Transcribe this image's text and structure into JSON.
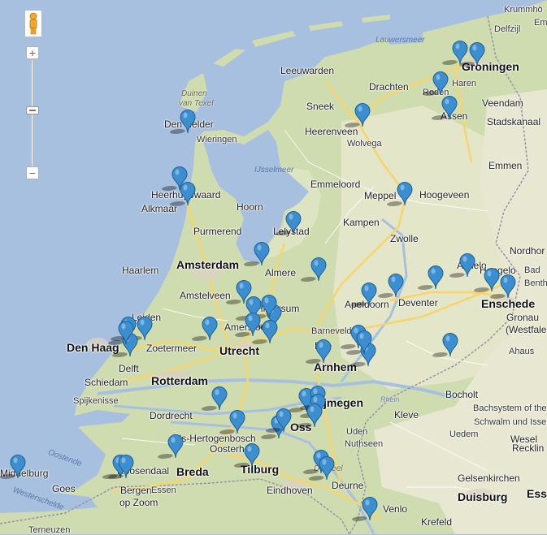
{
  "map": {
    "colors": {
      "water": "#a7c0df",
      "land_green": "#cfdcb0",
      "land_light": "#e6e9cf",
      "road_major": "#f7d56a",
      "road_minor": "#ffffff",
      "border": "#9a8fa6",
      "pin": "#3b8fd0"
    },
    "labels": [
      {
        "text": "Krummhö",
        "type": "small"
      },
      {
        "text": "Delfzijl",
        "type": "small"
      },
      {
        "text": "Em",
        "type": "small"
      },
      {
        "text": "Lauwersmeer",
        "type": "water"
      },
      {
        "text": "Groningen",
        "type": "big"
      },
      {
        "text": "Leeuwarden",
        "type": "normal"
      },
      {
        "text": "Drachten",
        "type": "normal"
      },
      {
        "text": "Haren",
        "type": "small"
      },
      {
        "text": "Roden",
        "type": "small"
      },
      {
        "text": "Duinen",
        "type": "region"
      },
      {
        "text": "van Texel",
        "type": "region"
      },
      {
        "text": "Sneek",
        "type": "normal"
      },
      {
        "text": "Veendam",
        "type": "normal"
      },
      {
        "text": "Assen",
        "type": "normal"
      },
      {
        "text": "Stadskanaal",
        "type": "normal"
      },
      {
        "text": "Den Helder",
        "type": "normal"
      },
      {
        "text": "Heerenveen",
        "type": "normal"
      },
      {
        "text": "Wieringen",
        "type": "small"
      },
      {
        "text": "Wolvega",
        "type": "small"
      },
      {
        "text": "IJsselmeer",
        "type": "water"
      },
      {
        "text": "Emmen",
        "type": "normal"
      },
      {
        "text": "Emmeloord",
        "type": "normal"
      },
      {
        "text": "Heerhugowaard",
        "type": "normal"
      },
      {
        "text": "Hoorn",
        "type": "normal"
      },
      {
        "text": "Meppel",
        "type": "normal"
      },
      {
        "text": "Hoogeveen",
        "type": "normal"
      },
      {
        "text": "Alkmaar",
        "type": "normal"
      },
      {
        "text": "Kampen",
        "type": "normal"
      },
      {
        "text": "Lelystad",
        "type": "normal"
      },
      {
        "text": "Purmerend",
        "type": "normal"
      },
      {
        "text": "Zwolle",
        "type": "normal"
      },
      {
        "text": "Nordhor",
        "type": "normal"
      },
      {
        "text": "Haarlem",
        "type": "normal"
      },
      {
        "text": "Amsterdam",
        "type": "big"
      },
      {
        "text": "Almere",
        "type": "normal"
      },
      {
        "text": "Almelo",
        "type": "normal"
      },
      {
        "text": "Hengelo",
        "type": "normal"
      },
      {
        "text": "Bad",
        "type": "small"
      },
      {
        "text": "Benth",
        "type": "small"
      },
      {
        "text": "Amstelveen",
        "type": "normal"
      },
      {
        "text": "Hilversum",
        "type": "normal"
      },
      {
        "text": "Apeldoorn",
        "type": "normal"
      },
      {
        "text": "Deventer",
        "type": "normal"
      },
      {
        "text": "Enschede",
        "type": "big"
      },
      {
        "text": "Leiden",
        "type": "normal"
      },
      {
        "text": "Amersfoort",
        "type": "normal"
      },
      {
        "text": "Barneveld",
        "type": "small"
      },
      {
        "text": "Gronau",
        "type": "normal"
      },
      {
        "text": "(Westfalen)",
        "type": "normal"
      },
      {
        "text": "Den Haag",
        "type": "big"
      },
      {
        "text": "Zoetermeer",
        "type": "normal"
      },
      {
        "text": "Utrecht",
        "type": "big"
      },
      {
        "text": "Ede",
        "type": "normal"
      },
      {
        "text": "Ahaus",
        "type": "small"
      },
      {
        "text": "Delft",
        "type": "normal"
      },
      {
        "text": "Arnhem",
        "type": "big"
      },
      {
        "text": "Schiedam",
        "type": "normal"
      },
      {
        "text": "Rotterdam",
        "type": "big"
      },
      {
        "text": "Spijkenisse",
        "type": "small"
      },
      {
        "text": "Bocholt",
        "type": "normal"
      },
      {
        "text": "Rhein",
        "type": "river"
      },
      {
        "text": "Nijmegen",
        "type": "big"
      },
      {
        "text": "Bachsystem of the",
        "type": "small"
      },
      {
        "text": "Dordrecht",
        "type": "normal"
      },
      {
        "text": "Kleve",
        "type": "normal"
      },
      {
        "text": "Schwalm und Issel",
        "type": "small"
      },
      {
        "text": "Oss",
        "type": "big"
      },
      {
        "text": "Uedem",
        "type": "small"
      },
      {
        "text": "Wesel",
        "type": "normal"
      },
      {
        "text": "Uden",
        "type": "small"
      },
      {
        "text": "'s-Hertogenbosch",
        "type": "normal"
      },
      {
        "text": "Nuthseen",
        "type": "small"
      },
      {
        "text": "Oosterhout",
        "type": "normal"
      },
      {
        "text": "Recklin",
        "type": "normal"
      },
      {
        "text": "Oostende",
        "type": "water"
      },
      {
        "text": "Roosendaal",
        "type": "normal"
      },
      {
        "text": "Breda",
        "type": "big"
      },
      {
        "text": "Tilburg",
        "type": "big"
      },
      {
        "text": "De Peel",
        "type": "region"
      },
      {
        "text": "Middelburg",
        "type": "normal"
      },
      {
        "text": "Goes",
        "type": "normal"
      },
      {
        "text": "Bergen",
        "type": "normal"
      },
      {
        "text": "op Zoom",
        "type": "normal"
      },
      {
        "text": "Essen",
        "type": "small"
      },
      {
        "text": "Eindhoven",
        "type": "normal"
      },
      {
        "text": "Deurne",
        "type": "normal"
      },
      {
        "text": "Gelsenkirchen",
        "type": "normal"
      },
      {
        "text": "Ess",
        "type": "big"
      },
      {
        "text": "Westerschelde",
        "type": "water"
      },
      {
        "text": "Duisburg",
        "type": "big"
      },
      {
        "text": "Venlo",
        "type": "normal"
      },
      {
        "text": "Terneuzen",
        "type": "small"
      },
      {
        "text": "Krefeld",
        "type": "normal"
      }
    ],
    "markers": [
      "Groningen",
      "Groningen",
      "Roden",
      "Assen",
      "Den Helder",
      "Heerenveen",
      "Heerhugowaard",
      "Heerhugowaard",
      "Hoogeveen",
      "Lelystad",
      "Almere",
      "Hattem",
      "Almelo",
      "Hengelo",
      "Enschede",
      "Enschede",
      "Apeldoorn",
      "Deventer",
      "Lochem",
      "Amsterdam",
      "Hilversum",
      "Hilversum",
      "Amersfoort",
      "Amersfoort",
      "Utrecht",
      "Woerden",
      "Den Haag",
      "Leiden",
      "Delft",
      "Ede",
      "Ede",
      "Ede",
      "Arnhem",
      "Winterswijk",
      "Nijmegen",
      "Nijmegen",
      "Nijmegen",
      "Nijmegen",
      "Oss",
      "Oss",
      "Gorinchem",
      "'s-Hertogenbosch",
      "Breda",
      "Tilburg",
      "Roosendaal",
      "Roosendaal",
      "Middelburg",
      "Deurne",
      "Helmond",
      "Venlo"
    ]
  }
}
